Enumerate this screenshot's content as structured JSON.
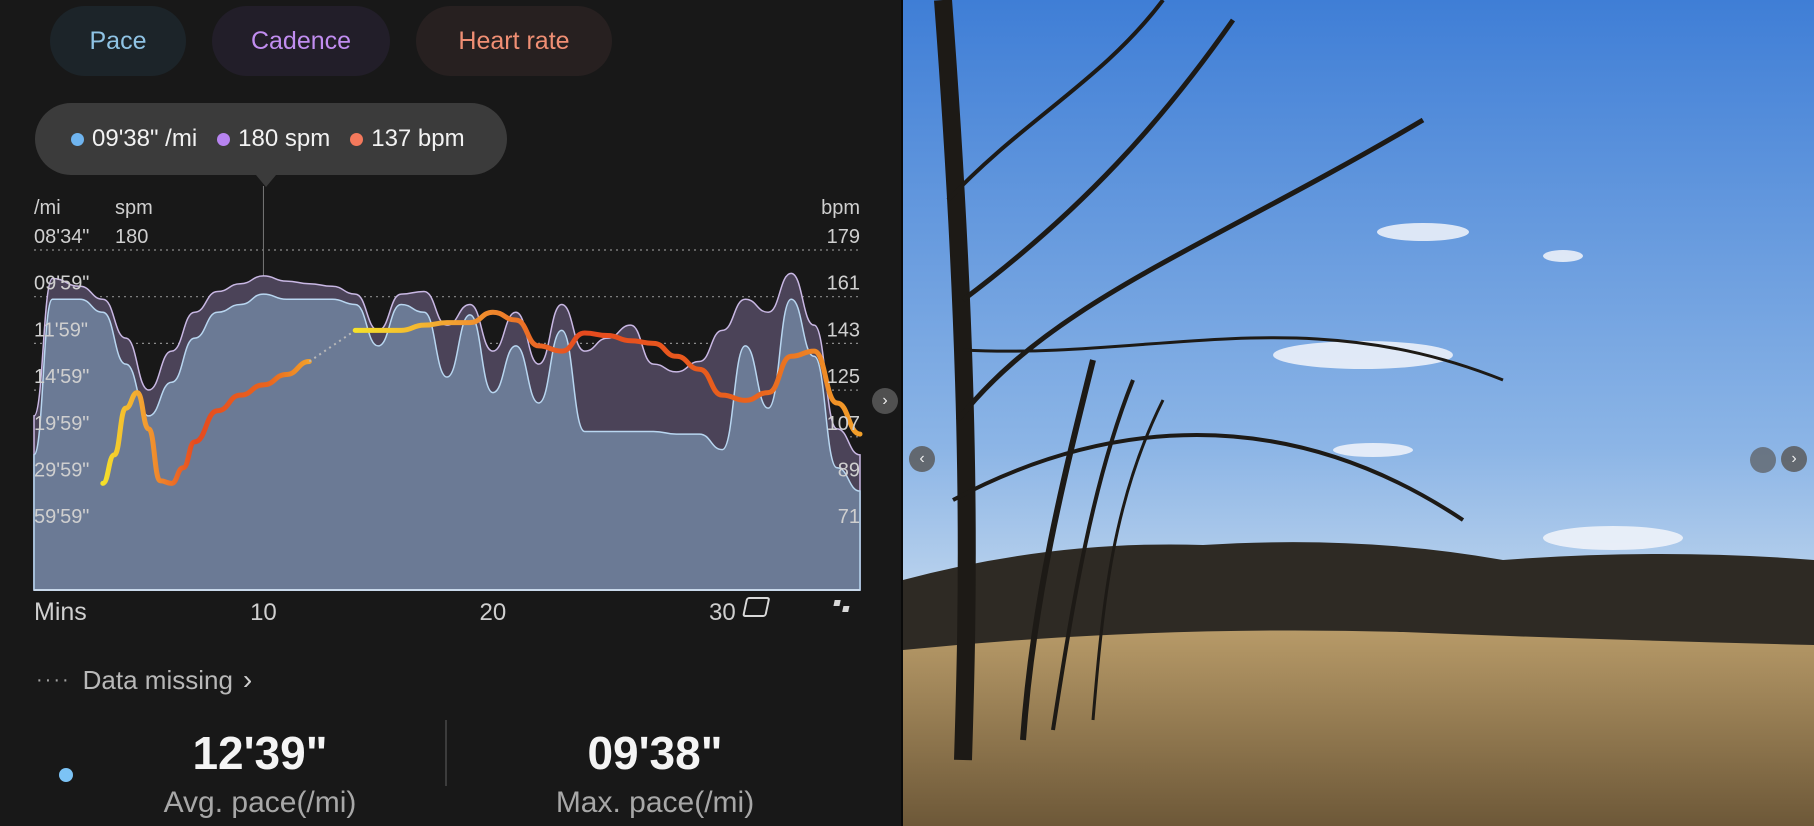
{
  "tabs": [
    {
      "label": "Pace",
      "color": "#8fc3e4"
    },
    {
      "label": "Cadence",
      "color": "#c18df0"
    },
    {
      "label": "Heart rate",
      "color": "#f08f74"
    }
  ],
  "tooltip": {
    "pace": "09'38\" /mi",
    "cadence": "180 spm",
    "heart_rate": "137 bpm",
    "pace_color": "#6fb4ef",
    "cadence_color": "#b784f0",
    "hr_color": "#f4795c"
  },
  "chart_data": {
    "type": "area",
    "x_label": "Mins",
    "x_ticks": [
      "10",
      "20",
      "30"
    ],
    "left_unit_pace": "/mi",
    "left_unit_cadence": "spm",
    "right_unit": "bpm",
    "pace_ticks": [
      "08'34\"",
      "09'59\"",
      "11'59\"",
      "14'59\"",
      "19'59\"",
      "29'59\"",
      "59'59\""
    ],
    "cadence_ticks": [
      "180"
    ],
    "bpm_ticks": [
      "179",
      "161",
      "143",
      "125",
      "107",
      "89",
      "71"
    ],
    "series": [
      {
        "name": "Pace",
        "values_note": "pace area"
      },
      {
        "name": "Cadence",
        "values_note": "cadence area"
      },
      {
        "name": "Heart rate",
        "values_note": "heart rate line"
      }
    ],
    "x_range": [
      0,
      36
    ],
    "bpm_range": [
      71,
      179
    ],
    "heart_rate": {
      "x": [
        3,
        3.5,
        4,
        4.5,
        5,
        5.5,
        6,
        6.5,
        7,
        8,
        9,
        10,
        11,
        12,
        14,
        15,
        16,
        17,
        18,
        19,
        20,
        21,
        22,
        23,
        24,
        25,
        26,
        27,
        28,
        29,
        30,
        31,
        32,
        33,
        34,
        35,
        36
      ],
      "y": [
        89,
        100,
        118,
        124,
        110,
        90,
        89,
        95,
        105,
        117,
        123,
        127,
        131,
        136,
        148,
        148,
        148,
        150,
        151,
        151,
        155,
        152,
        142,
        140,
        147,
        146,
        144,
        143,
        138,
        133,
        123,
        121,
        124,
        138,
        140,
        120,
        108
      ]
    },
    "cadence": {
      "x": [
        0,
        0.8,
        2,
        3,
        4,
        5,
        6,
        7,
        8,
        9,
        10,
        11,
        12,
        13,
        14,
        15,
        16,
        17,
        18,
        19,
        20,
        21,
        22,
        23,
        24,
        25,
        26,
        27,
        28,
        29,
        30,
        31,
        32,
        33,
        34,
        35,
        36
      ],
      "y": [
        115,
        168,
        165,
        160,
        145,
        125,
        140,
        155,
        163,
        166,
        169,
        167,
        166,
        165,
        162,
        148,
        162,
        163,
        150,
        158,
        140,
        155,
        135,
        158,
        140,
        145,
        150,
        135,
        132,
        136,
        148,
        160,
        155,
        170,
        150,
        110,
        100
      ]
    },
    "pace": {
      "x": [
        0,
        0.8,
        2,
        3,
        4,
        5,
        6,
        7,
        8,
        9,
        10,
        11,
        12,
        13,
        14,
        15,
        16,
        17,
        18,
        19,
        20,
        21,
        22,
        23,
        24,
        25,
        26,
        27,
        28,
        29,
        30,
        31,
        32,
        33,
        34,
        35,
        36
      ],
      "y": [
        100,
        160,
        160,
        155,
        135,
        115,
        128,
        145,
        155,
        158,
        162,
        160,
        160,
        160,
        158,
        142,
        158,
        155,
        130,
        154,
        124,
        142,
        120,
        148,
        109,
        109,
        109,
        109,
        108,
        108,
        102,
        142,
        118,
        160,
        138,
        95,
        86
      ]
    },
    "gridlines": true,
    "legend": "top"
  },
  "data_missing": {
    "label": "Data missing"
  },
  "stats": {
    "avg_value": "12'39\"",
    "avg_label": "Avg. pace(/mi)",
    "max_value": "09'38\"",
    "max_label": "Max. pace(/mi)"
  },
  "photo": {
    "sky_color": "#5e94db",
    "field_color": "#9c8358"
  }
}
